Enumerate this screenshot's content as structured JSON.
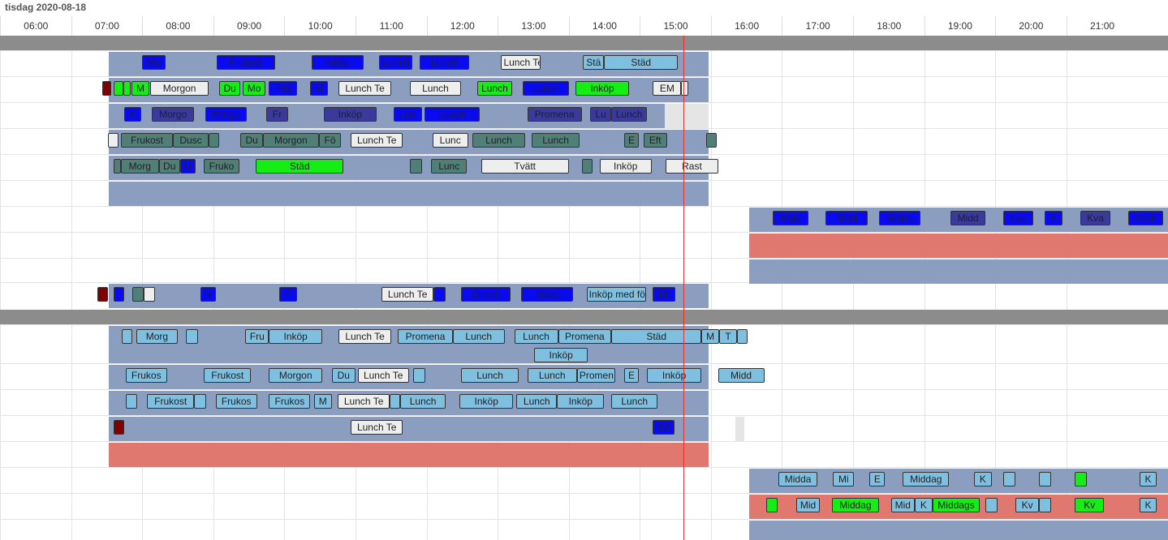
{
  "date_label": "tisdag 2020-08-18",
  "hours": [
    "06:00",
    "07:00",
    "08:00",
    "09:00",
    "10:00",
    "11:00",
    "12:00",
    "13:00",
    "14:00",
    "15:00",
    "16:00",
    "17:00",
    "18:00",
    "19:00",
    "20:00",
    "21:00"
  ],
  "time_axis": {
    "start_hour": 5.5,
    "end_hour": 21.93
  },
  "current_time": "15:07",
  "colors": {
    "blue": "#0a0aee",
    "navy": "#3a3a9a",
    "teal": "#4f7f76",
    "light": "#eeeeee",
    "green": "#14ee14",
    "sky": "#7fbfdf",
    "darkred": "#800000",
    "band_blue": "#8b9ec0",
    "band_red": "#e07870",
    "band_gray": "#e5e5e5",
    "separator": "#8c8c8c",
    "now_line": "#e03030"
  },
  "rows": [
    {
      "events": [
        {
          "label": "Mo",
          "start": "07:30",
          "end": "07:50",
          "color": "blue"
        },
        {
          "label": "Frukost",
          "start": "08:33",
          "end": "09:22",
          "color": "blue"
        },
        {
          "label": "Inköp",
          "start": "09:53",
          "end": "10:37",
          "color": "blue"
        },
        {
          "label": "Lunch",
          "start": "10:50",
          "end": "11:18",
          "color": "blue"
        },
        {
          "label": "Lunch",
          "start": "11:24",
          "end": "12:06",
          "color": "blue"
        },
        {
          "label": "Lunch Te",
          "start": "12:33",
          "end": "13:06",
          "color": "light"
        },
        {
          "label": "Stä",
          "start": "13:42",
          "end": "14:00",
          "color": "sky"
        },
        {
          "label": "Städ",
          "start": "14:00",
          "end": "15:02",
          "color": "sky"
        }
      ]
    },
    {
      "events": [
        {
          "label": "",
          "start": "06:56",
          "end": "07:04",
          "color": "darkred"
        },
        {
          "label": "",
          "start": "07:06",
          "end": "07:14",
          "color": "green"
        },
        {
          "label": "",
          "start": "07:14",
          "end": "07:20",
          "color": "green"
        },
        {
          "label": "M",
          "start": "07:21",
          "end": "07:36",
          "color": "green"
        },
        {
          "label": "Morgon",
          "start": "07:37",
          "end": "08:26",
          "color": "light"
        },
        {
          "label": "Du",
          "start": "08:35",
          "end": "08:53",
          "color": "green"
        },
        {
          "label": "Mo",
          "start": "08:55",
          "end": "09:14",
          "color": "green"
        },
        {
          "label": "Fru",
          "start": "09:17",
          "end": "09:41",
          "color": "blue"
        },
        {
          "label": "M",
          "start": "09:52",
          "end": "10:07",
          "color": "blue"
        },
        {
          "label": "Lunch Te",
          "start": "10:16",
          "end": "11:00",
          "color": "light"
        },
        {
          "label": "Lunch",
          "start": "11:16",
          "end": "11:59",
          "color": "light"
        },
        {
          "label": "Lunch",
          "start": "12:13",
          "end": "12:42",
          "color": "green"
        },
        {
          "label": "Lunch",
          "start": "12:51",
          "end": "13:30",
          "color": "blue"
        },
        {
          "label": "inköp",
          "start": "13:36",
          "end": "14:21",
          "color": "green"
        },
        {
          "label": "EM",
          "start": "14:41",
          "end": "15:05",
          "color": "light"
        },
        {
          "label": "",
          "start": "15:05",
          "end": "15:11",
          "color": "light"
        }
      ]
    },
    {
      "gray_from": "14:51",
      "events": [
        {
          "label": "K",
          "start": "07:15",
          "end": "07:29",
          "color": "blue"
        },
        {
          "label": "Morgo",
          "start": "07:38",
          "end": "08:14",
          "color": "navy"
        },
        {
          "label": "Morgo",
          "start": "08:23",
          "end": "08:58",
          "color": "blue"
        },
        {
          "label": "Fr",
          "start": "09:15",
          "end": "09:33",
          "color": "navy"
        },
        {
          "label": "Inköp",
          "start": "10:03",
          "end": "10:48",
          "color": "navy"
        },
        {
          "label": "Lun",
          "start": "11:02",
          "end": "11:26",
          "color": "blue"
        },
        {
          "label": "Dusch",
          "start": "11:28",
          "end": "12:15",
          "color": "blue"
        },
        {
          "label": "Promena",
          "start": "12:55",
          "end": "13:41",
          "color": "navy"
        },
        {
          "label": "Lu",
          "start": "13:48",
          "end": "14:06",
          "color": "navy"
        },
        {
          "label": "Lunch",
          "start": "14:06",
          "end": "14:36",
          "color": "navy"
        }
      ]
    },
    {
      "events": [
        {
          "label": "",
          "start": "07:01",
          "end": "07:10",
          "color": "light"
        },
        {
          "label": "Frukost",
          "start": "07:12",
          "end": "07:56",
          "color": "teal"
        },
        {
          "label": "Dusc",
          "start": "07:56",
          "end": "08:26",
          "color": "teal"
        },
        {
          "label": "",
          "start": "08:26",
          "end": "08:35",
          "color": "teal"
        },
        {
          "label": "Du",
          "start": "08:53",
          "end": "09:12",
          "color": "teal"
        },
        {
          "label": "Morgon",
          "start": "09:12",
          "end": "09:59",
          "color": "teal"
        },
        {
          "label": "Fö",
          "start": "09:59",
          "end": "10:18",
          "color": "teal"
        },
        {
          "label": "Lunch Te",
          "start": "10:26",
          "end": "11:10",
          "color": "light"
        },
        {
          "label": "Lunc",
          "start": "11:35",
          "end": "12:05",
          "color": "light"
        },
        {
          "label": "Lunch",
          "start": "12:09",
          "end": "12:53",
          "color": "teal"
        },
        {
          "label": "Lunch",
          "start": "12:59",
          "end": "13:39",
          "color": "teal"
        },
        {
          "label": "E",
          "start": "14:17",
          "end": "14:29",
          "color": "teal"
        },
        {
          "label": "Eft",
          "start": "14:33",
          "end": "14:53",
          "color": "teal"
        },
        {
          "label": "",
          "start": "15:26",
          "end": "15:35",
          "color": "teal"
        }
      ]
    },
    {
      "events": [
        {
          "label": "",
          "start": "07:06",
          "end": "07:12",
          "color": "teal"
        },
        {
          "label": "Morg",
          "start": "07:12",
          "end": "07:44",
          "color": "teal"
        },
        {
          "label": "Du",
          "start": "07:44",
          "end": "08:02",
          "color": "teal"
        },
        {
          "label": "U",
          "start": "08:02",
          "end": "08:15",
          "color": "blue"
        },
        {
          "label": "Fruko",
          "start": "08:22",
          "end": "08:52",
          "color": "teal"
        },
        {
          "label": "Städ",
          "start": "09:06",
          "end": "10:20",
          "color": "green"
        },
        {
          "label": "",
          "start": "11:16",
          "end": "11:26",
          "color": "teal"
        },
        {
          "label": "Lunc",
          "start": "11:34",
          "end": "12:04",
          "color": "teal"
        },
        {
          "label": "Tvätt",
          "start": "12:16",
          "end": "13:30",
          "color": "light"
        },
        {
          "label": "",
          "start": "13:41",
          "end": "13:50",
          "color": "teal"
        },
        {
          "label": "Inköp",
          "start": "13:56",
          "end": "14:40",
          "color": "light"
        },
        {
          "label": "Rast",
          "start": "14:52",
          "end": "15:36",
          "color": "light"
        }
      ]
    },
    {
      "events": []
    },
    {
      "events": [
        {
          "label": "Midd",
          "start": "16:22",
          "end": "16:52",
          "color": "blue"
        },
        {
          "label": "Midd",
          "start": "17:07",
          "end": "17:42",
          "color": "blue"
        },
        {
          "label": "Midda",
          "start": "17:52",
          "end": "18:27",
          "color": "blue"
        },
        {
          "label": "Midd",
          "start": "18:52",
          "end": "19:22",
          "color": "navy"
        },
        {
          "label": "Kva",
          "start": "19:37",
          "end": "20:02",
          "color": "blue"
        },
        {
          "label": "K",
          "start": "20:12",
          "end": "20:27",
          "color": "blue"
        },
        {
          "label": "Kva",
          "start": "20:42",
          "end": "21:07",
          "color": "navy"
        },
        {
          "label": "Kvall",
          "start": "21:22",
          "end": "21:52",
          "color": "blue"
        }
      ]
    },
    {
      "events": []
    },
    {
      "events": []
    },
    {
      "events": [
        {
          "label": "",
          "start": "06:52",
          "end": "07:01",
          "color": "darkred"
        },
        {
          "label": "",
          "start": "07:06",
          "end": "07:15",
          "color": "blue"
        },
        {
          "label": "",
          "start": "07:22",
          "end": "07:31",
          "color": "teal"
        },
        {
          "label": "",
          "start": "07:31",
          "end": "07:41",
          "color": "light"
        },
        {
          "label": "N",
          "start": "08:19",
          "end": "08:32",
          "color": "blue"
        },
        {
          "label": "F",
          "start": "09:26",
          "end": "09:41",
          "color": "blue"
        },
        {
          "label": "Lunch Te",
          "start": "10:52",
          "end": "11:36",
          "color": "light"
        },
        {
          "label": "",
          "start": "11:36",
          "end": "11:46",
          "color": "blue"
        },
        {
          "label": "Dusch",
          "start": "11:59",
          "end": "12:41",
          "color": "blue"
        },
        {
          "label": "Inköp",
          "start": "12:50",
          "end": "13:34",
          "color": "blue"
        },
        {
          "label": "Inköp med fö",
          "start": "13:45",
          "end": "14:35",
          "color": "sky"
        },
        {
          "label": "Eft",
          "start": "14:41",
          "end": "15:00",
          "color": "blue"
        }
      ]
    },
    {
      "events": [
        {
          "label": "",
          "start": "07:13",
          "end": "07:22",
          "color": "sky"
        },
        {
          "label": "Morg",
          "start": "07:25",
          "end": "08:00",
          "color": "sky"
        },
        {
          "label": "",
          "start": "08:07",
          "end": "08:17",
          "color": "sky"
        },
        {
          "label": "Fru",
          "start": "08:57",
          "end": "09:17",
          "color": "sky"
        },
        {
          "label": "Inköp",
          "start": "09:17",
          "end": "10:02",
          "color": "sky"
        },
        {
          "label": "Lunch Te",
          "start": "10:16",
          "end": "11:00",
          "color": "light"
        },
        {
          "label": "Promena",
          "start": "11:06",
          "end": "11:52",
          "color": "sky"
        },
        {
          "label": "Lunch",
          "start": "11:52",
          "end": "12:36",
          "color": "sky"
        },
        {
          "label": "Lunch",
          "start": "12:44",
          "end": "13:21",
          "color": "sky"
        },
        {
          "label": "Promena",
          "start": "13:21",
          "end": "14:06",
          "color": "sky"
        },
        {
          "label": "Städ",
          "start": "14:06",
          "end": "15:22",
          "color": "sky"
        },
        {
          "label": "M",
          "start": "15:22",
          "end": "15:37",
          "color": "sky"
        },
        {
          "label": "T",
          "start": "15:37",
          "end": "15:52",
          "color": "sky"
        },
        {
          "label": "",
          "start": "15:52",
          "end": "16:01",
          "color": "sky"
        },
        {
          "label": "Inköp",
          "start": "13:01",
          "end": "13:46",
          "color": "sky",
          "lane": 1
        }
      ]
    },
    {
      "events": [
        {
          "label": "Frukos",
          "start": "07:16",
          "end": "07:51",
          "color": "sky"
        },
        {
          "label": "Frukost",
          "start": "08:22",
          "end": "09:02",
          "color": "sky"
        },
        {
          "label": "Morgon",
          "start": "09:17",
          "end": "10:02",
          "color": "sky"
        },
        {
          "label": "Du",
          "start": "10:10",
          "end": "10:30",
          "color": "sky"
        },
        {
          "label": "Lunch Te",
          "start": "10:32",
          "end": "11:15",
          "color": "light"
        },
        {
          "label": "",
          "start": "11:19",
          "end": "11:29",
          "color": "sky"
        },
        {
          "label": "Lunch",
          "start": "11:59",
          "end": "12:48",
          "color": "sky"
        },
        {
          "label": "Lunch",
          "start": "12:55",
          "end": "13:37",
          "color": "sky"
        },
        {
          "label": "Promen",
          "start": "13:37",
          "end": "14:09",
          "color": "sky"
        },
        {
          "label": "E",
          "start": "14:17",
          "end": "14:29",
          "color": "sky"
        },
        {
          "label": "Inköp",
          "start": "14:36",
          "end": "15:22",
          "color": "sky"
        },
        {
          "label": "Midd",
          "start": "15:36",
          "end": "16:15",
          "color": "sky"
        }
      ]
    },
    {
      "events": [
        {
          "label": "",
          "start": "07:16",
          "end": "07:26",
          "color": "sky"
        },
        {
          "label": "Frukost",
          "start": "07:34",
          "end": "08:14",
          "color": "sky"
        },
        {
          "label": "",
          "start": "08:14",
          "end": "08:24",
          "color": "sky"
        },
        {
          "label": "Frukos",
          "start": "08:32",
          "end": "09:07",
          "color": "sky"
        },
        {
          "label": "Frukos",
          "start": "09:17",
          "end": "09:52",
          "color": "sky"
        },
        {
          "label": "M",
          "start": "09:55",
          "end": "10:10",
          "color": "sky"
        },
        {
          "label": "Lunch Te",
          "start": "10:15",
          "end": "10:59",
          "color": "light"
        },
        {
          "label": "",
          "start": "10:59",
          "end": "11:08",
          "color": "sky"
        },
        {
          "label": "Lunch",
          "start": "11:08",
          "end": "11:46",
          "color": "sky"
        },
        {
          "label": "Inköp",
          "start": "11:58",
          "end": "12:43",
          "color": "sky"
        },
        {
          "label": "Lunch",
          "start": "12:46",
          "end": "13:20",
          "color": "sky"
        },
        {
          "label": "Inköp",
          "start": "13:20",
          "end": "14:00",
          "color": "sky"
        },
        {
          "label": "Lunch",
          "start": "14:06",
          "end": "14:45",
          "color": "sky"
        }
      ]
    },
    {
      "gray_from": "15:51",
      "events": [
        {
          "label": "",
          "start": "07:06",
          "end": "07:15",
          "color": "darkred"
        },
        {
          "label": "Lunch Te",
          "start": "10:26",
          "end": "11:10",
          "color": "light"
        },
        {
          "label": "Eft",
          "start": "14:41",
          "end": "14:59",
          "color": "blue"
        }
      ]
    },
    {
      "events": []
    },
    {
      "events": [
        {
          "label": "Midda",
          "start": "16:27",
          "end": "17:00",
          "color": "sky"
        },
        {
          "label": "Mi",
          "start": "17:13",
          "end": "17:31",
          "color": "sky"
        },
        {
          "label": "E",
          "start": "17:44",
          "end": "17:57",
          "color": "sky"
        },
        {
          "label": "Middag",
          "start": "18:12",
          "end": "18:51",
          "color": "sky"
        },
        {
          "label": "K",
          "start": "19:12",
          "end": "19:27",
          "color": "sky"
        },
        {
          "label": "",
          "start": "19:37",
          "end": "19:47",
          "color": "sky"
        },
        {
          "label": "",
          "start": "20:07",
          "end": "20:17",
          "color": "sky"
        },
        {
          "label": "",
          "start": "20:37",
          "end": "20:47",
          "color": "green"
        },
        {
          "label": "K",
          "start": "21:32",
          "end": "21:46",
          "color": "sky"
        }
      ]
    },
    {
      "events": [
        {
          "label": "",
          "start": "16:17",
          "end": "16:26",
          "color": "green"
        },
        {
          "label": "Mid",
          "start": "16:42",
          "end": "17:02",
          "color": "sky"
        },
        {
          "label": "Middag",
          "start": "17:12",
          "end": "17:52",
          "color": "green"
        },
        {
          "label": "Mid",
          "start": "18:02",
          "end": "18:22",
          "color": "sky"
        },
        {
          "label": "K",
          "start": "18:22",
          "end": "18:37",
          "color": "sky"
        },
        {
          "label": "Middags",
          "start": "18:37",
          "end": "19:17",
          "color": "green"
        },
        {
          "label": "",
          "start": "19:22",
          "end": "19:32",
          "color": "sky"
        },
        {
          "label": "Kv",
          "start": "19:47",
          "end": "20:07",
          "color": "sky"
        },
        {
          "label": "",
          "start": "20:07",
          "end": "20:17",
          "color": "sky"
        },
        {
          "label": "Kv",
          "start": "20:37",
          "end": "21:02",
          "color": "green"
        },
        {
          "label": "K",
          "start": "21:32",
          "end": "21:46",
          "color": "sky"
        }
      ]
    },
    {
      "events": []
    }
  ]
}
